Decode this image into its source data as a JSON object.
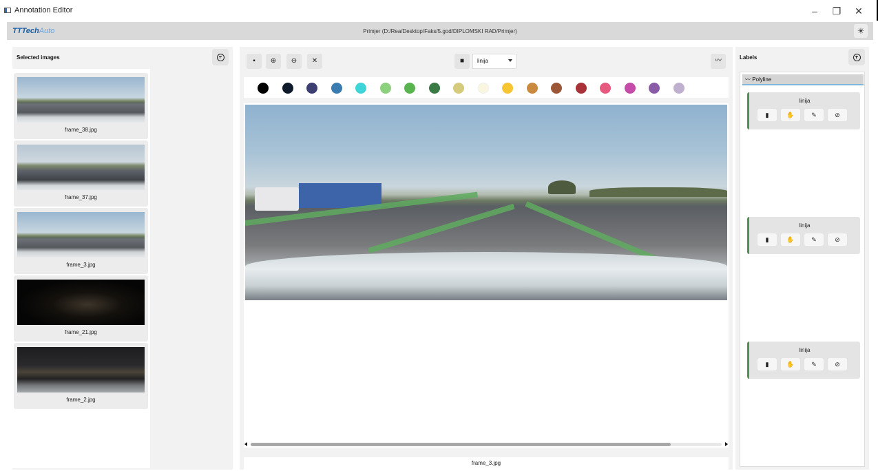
{
  "window": {
    "title": "Annotation Editor",
    "controls": [
      "–",
      "❐",
      "✕"
    ]
  },
  "header": {
    "brand_bold": "TTTech",
    "brand_light": "Auto",
    "project_path": "Primjer (D:/Rea/Desktop/Faks/5.god/DIPLOMSKI RAD/Primjer)",
    "theme_icon": "☀"
  },
  "left_panel": {
    "title": "Selected images",
    "images": [
      {
        "filename": "frame_38.jpg"
      },
      {
        "filename": "frame_37.jpg"
      },
      {
        "filename": "frame_3.jpg"
      },
      {
        "filename": "frame_21.jpg"
      },
      {
        "filename": "frame_2.jpg"
      }
    ]
  },
  "center": {
    "toolbar": {
      "save_icon": "save-icon",
      "zoom_in_icon": "zoom-in-icon",
      "zoom_out_icon": "zoom-out-icon",
      "close_icon": "close-icon",
      "label_value": "linija",
      "polyline_icon": "polyline-icon"
    },
    "palette": [
      "#000000",
      "#0f1a2b",
      "#3d3f73",
      "#3a7cb0",
      "#3fd5d8",
      "#8cd17d",
      "#59b44f",
      "#3a7a45",
      "#d5cb7c",
      "#faf6e0",
      "#f7c531",
      "#c98a3e",
      "#9b5737",
      "#a83238",
      "#e55a7e",
      "#c54ca9",
      "#8a5ba6",
      "#c0b0cf"
    ],
    "current_file": "frame_3.jpg"
  },
  "right_panel": {
    "title": "Labels",
    "group": "Polyline",
    "labels": [
      {
        "name": "linija"
      },
      {
        "name": "linija"
      },
      {
        "name": "linija"
      }
    ]
  }
}
